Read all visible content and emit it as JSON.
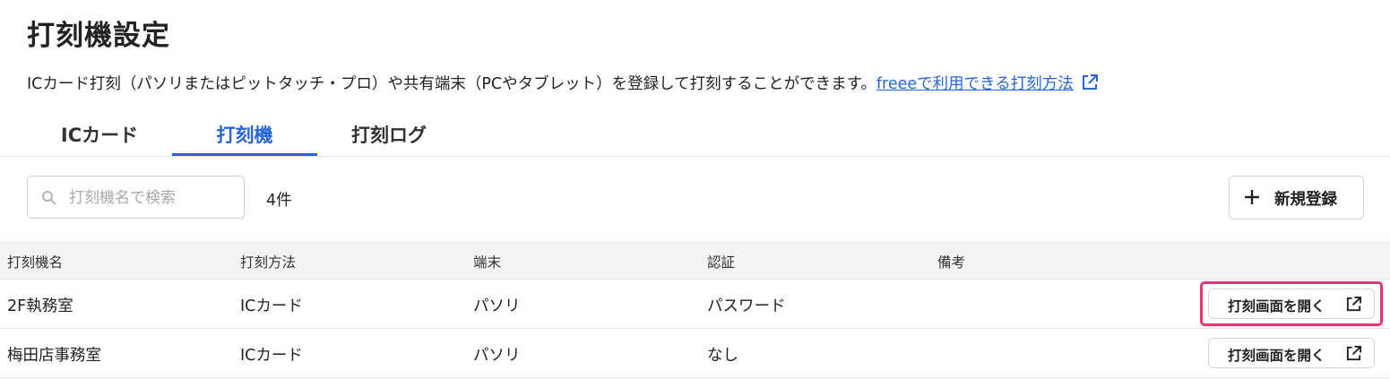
{
  "page": {
    "title": "打刻機設定",
    "description": "ICカード打刻（パソリまたはピットタッチ・プロ）や共有端末（PCやタブレット）を登録して打刻することができます。",
    "help_link": "freeeで利用できる打刻方法"
  },
  "tabs": [
    {
      "label": "ICカード",
      "active": false
    },
    {
      "label": "打刻機",
      "active": true
    },
    {
      "label": "打刻ログ",
      "active": false
    }
  ],
  "toolbar": {
    "search_placeholder": "打刻機名で検索",
    "search_value": "",
    "count": "4件",
    "new_button_label": "新規登録"
  },
  "table": {
    "headers": [
      "打刻機名",
      "打刻方法",
      "端末",
      "認証",
      "備考"
    ],
    "rows": [
      {
        "name": "2F執務室",
        "method": "ICカード",
        "device": "パソリ",
        "auth": "パスワード",
        "note": "",
        "action_label": "打刻画面を開く",
        "highlighted": true
      },
      {
        "name": "梅田店事務室",
        "method": "ICカード",
        "device": "パソリ",
        "auth": "なし",
        "note": "",
        "action_label": "打刻画面を開く",
        "highlighted": false
      }
    ]
  },
  "colors": {
    "accent": "#2864d8",
    "highlight": "#e8357a",
    "header_bg": "#f4f4f4"
  },
  "icons": {
    "external_link": "external-link-icon",
    "search": "search-icon",
    "plus": "plus-icon"
  }
}
